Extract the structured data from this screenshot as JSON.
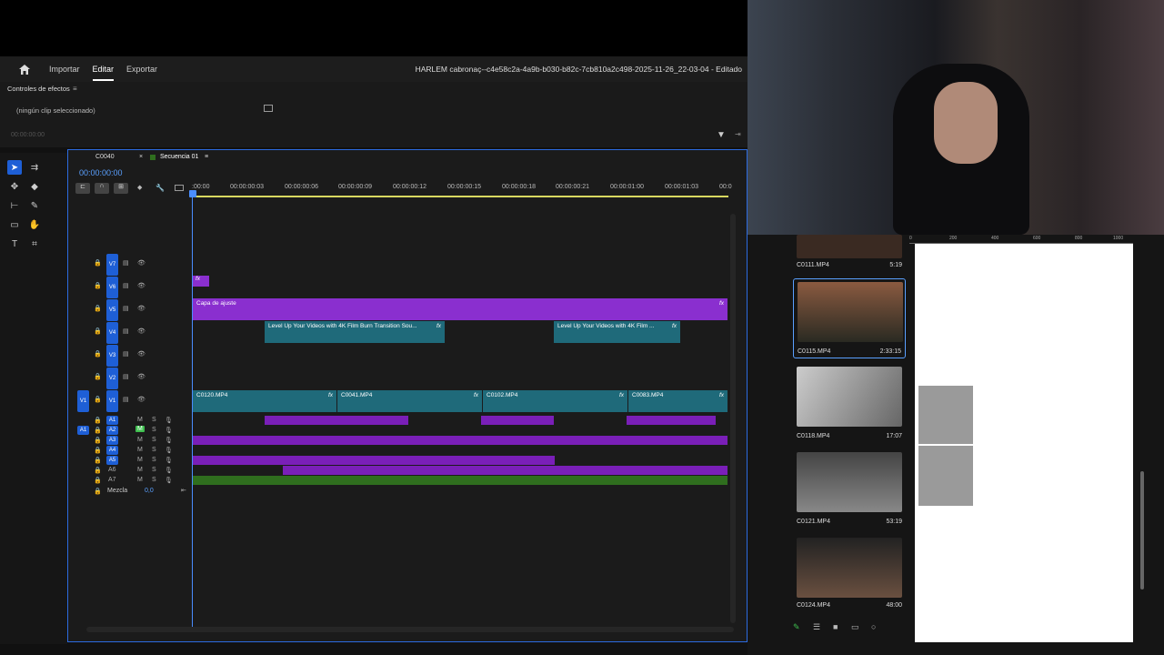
{
  "menu": {
    "importar": "Importar",
    "editar": "Editar",
    "exportar": "Exportar",
    "title": "HARLEM cabronaç--c4e58c2a-4a9b-b030-b82c-7cb810a2c498-2025-11-26_22-03-04 - Editado"
  },
  "effects": {
    "header": "Controles de efectos",
    "no_clip": "(ningún clip seleccionado)",
    "timecode": "00:00:00:00"
  },
  "timeline": {
    "tab1": "C0040",
    "tab2": "Secuencia 01",
    "timecode": "00:00:00:00",
    "ruler": [
      ":00:00",
      "00:00:00:03",
      "00:00:00:06",
      "00:00:00:09",
      "00:00:00:12",
      "00:00:00:15",
      "00:00:00:18",
      "00:00:00:21",
      "00:00:01:00",
      "00:00:01:03",
      "00:0"
    ],
    "video_tracks": [
      "V7",
      "V6",
      "V5",
      "V4",
      "V3",
      "V2",
      "V1"
    ],
    "audio_tracks": [
      "A1",
      "A2",
      "A3",
      "A4",
      "A5",
      "A6",
      "A7"
    ],
    "src_v": "V1",
    "src_a": "A1",
    "m_label": "M",
    "s_label": "S",
    "mix": "Mezcla",
    "mix_val": "0,0",
    "clips": {
      "adjust": "Capa de ajuste",
      "film1": "Level Up Your Videos with 4K Film Burn Transition Sou...",
      "film2": "Level Up Your Videos with 4K Film ...",
      "v1a": "C0120.MP4",
      "v1b": "C0041.MP4",
      "v1c": "C0102.MP4",
      "v1d": "C0083.MP4",
      "fx": "fx"
    }
  },
  "bin": [
    {
      "name": "C0111.MP4",
      "dur": "5:19"
    },
    {
      "name": "C0115.MP4",
      "dur": "2:33:15"
    },
    {
      "name": "C0118.MP4",
      "dur": "17:07"
    },
    {
      "name": "C0121.MP4",
      "dur": "53:19"
    },
    {
      "name": "C0124.MP4",
      "dur": "48:00"
    }
  ],
  "preview_ruler": [
    "0",
    "200",
    "400",
    "600",
    "800",
    "1000"
  ],
  "colors": {
    "accent": "#1e5fd6",
    "purple": "#7a1fb8",
    "teal": "#1f6a7a",
    "green": "#2f6e1e"
  }
}
